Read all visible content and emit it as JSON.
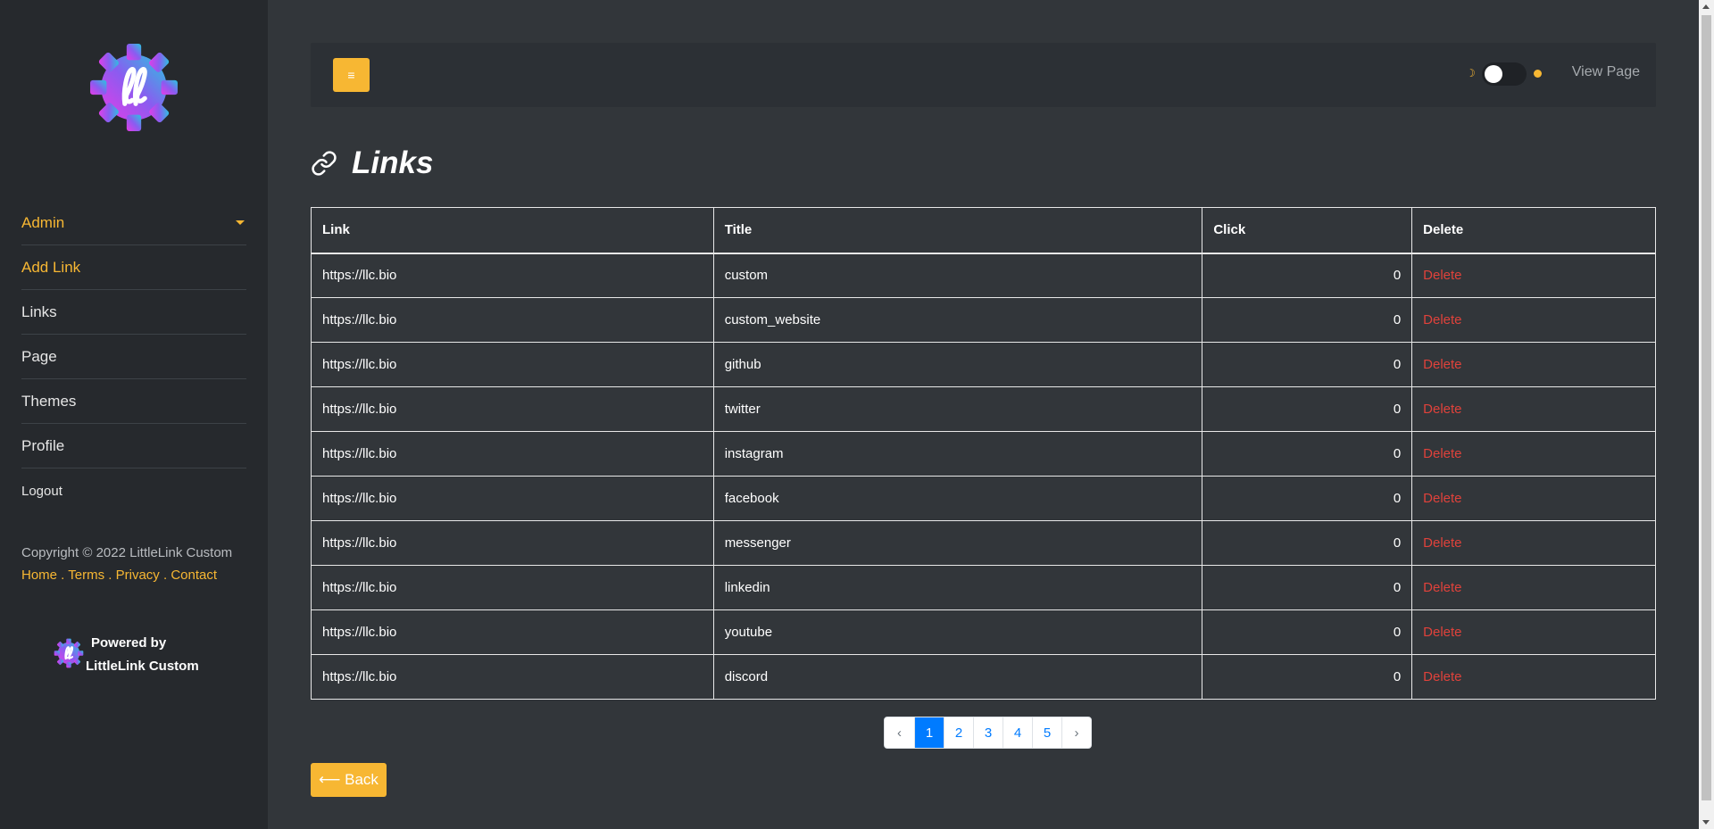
{
  "sidebar": {
    "items": [
      {
        "label": "Admin",
        "active": true,
        "has_caret": true
      },
      {
        "label": "Add Link",
        "active": true
      },
      {
        "label": "Links"
      },
      {
        "label": "Page"
      },
      {
        "label": "Themes"
      },
      {
        "label": "Profile"
      },
      {
        "label": "Logout"
      }
    ],
    "copyright": "Copyright © 2022 LittleLink Custom",
    "footer_links": [
      "Home",
      "Terms",
      "Privacy",
      "Contact"
    ],
    "footer_sep": " . ",
    "powered_line1": "Powered by",
    "powered_line2": "LittleLink Custom"
  },
  "topbar": {
    "menu_icon": "≡",
    "view_page_label": "View Page",
    "theme_toggle": "dark"
  },
  "main": {
    "title": "Links",
    "table": {
      "headers": [
        "Link",
        "Title",
        "Click",
        "Delete"
      ],
      "rows": [
        {
          "link": "https://llc.bio",
          "title": "custom",
          "clicks": "0",
          "action": "Delete"
        },
        {
          "link": "https://llc.bio",
          "title": "custom_website",
          "clicks": "0",
          "action": "Delete"
        },
        {
          "link": "https://llc.bio",
          "title": "github",
          "clicks": "0",
          "action": "Delete"
        },
        {
          "link": "https://llc.bio",
          "title": "twitter",
          "clicks": "0",
          "action": "Delete"
        },
        {
          "link": "https://llc.bio",
          "title": "instagram",
          "clicks": "0",
          "action": "Delete"
        },
        {
          "link": "https://llc.bio",
          "title": "facebook",
          "clicks": "0",
          "action": "Delete"
        },
        {
          "link": "https://llc.bio",
          "title": "messenger",
          "clicks": "0",
          "action": "Delete"
        },
        {
          "link": "https://llc.bio",
          "title": "linkedin",
          "clicks": "0",
          "action": "Delete"
        },
        {
          "link": "https://llc.bio",
          "title": "youtube",
          "clicks": "0",
          "action": "Delete"
        },
        {
          "link": "https://llc.bio",
          "title": "discord",
          "clicks": "0",
          "action": "Delete"
        }
      ]
    },
    "pagination": {
      "prev": "‹",
      "pages": [
        "1",
        "2",
        "3",
        "4",
        "5"
      ],
      "current": "1",
      "next": "›"
    },
    "back_label": "⟵ Back"
  },
  "colors": {
    "accent": "#f7b733",
    "danger": "#e0423b",
    "link_blue": "#007bff",
    "bg": "#32363a",
    "sidebar_bg": "#26292d"
  }
}
